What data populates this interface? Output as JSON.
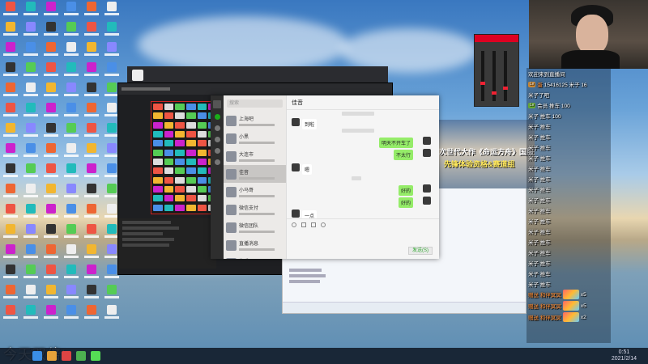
{
  "overlay": {
    "caption": "今天双倍!"
  },
  "taskbar": {
    "clock_time": "0:51",
    "clock_date": "2021/2/14"
  },
  "wechat": {
    "search_placeholder": "搜索",
    "chat_title": "佳音",
    "contacts": [
      {
        "name": "上海吧",
        "selected": false
      },
      {
        "name": "小黑",
        "selected": false
      },
      {
        "name": "大连市",
        "selected": false
      },
      {
        "name": "佳音",
        "selected": true
      },
      {
        "name": "小马哥",
        "selected": false
      },
      {
        "name": "微信支付",
        "selected": false
      },
      {
        "name": "微信团队",
        "selected": false
      },
      {
        "name": "直播消息",
        "selected": false
      },
      {
        "name": "快乐",
        "selected": false
      }
    ],
    "messages": [
      {
        "side": "left",
        "text": "到啦"
      },
      {
        "side": "right",
        "text": "明天不开车了"
      },
      {
        "side": "right",
        "text": "不太行"
      },
      {
        "side": "left",
        "text": "嗯"
      },
      {
        "side": "right",
        "text": "好的"
      },
      {
        "side": "right",
        "text": "好的"
      },
      {
        "side": "left",
        "text": "一点"
      }
    ],
    "send_label": "发送(S)"
  },
  "banner": {
    "title": "次世代大作《命运方舟》国服先锋启航",
    "subtitle": "先锋体验资格&赛道组"
  },
  "livechat": {
    "rows": [
      {
        "badge": "",
        "name": "",
        "text": "欢迎来到直播间"
      },
      {
        "badge": "Lv",
        "name": "蛋",
        "text": "15416125 米子 16"
      },
      {
        "badge": "",
        "name": "",
        "text": "米子了吧"
      },
      {
        "badge": "Lv",
        "name": "",
        "text": "会员 推车 100"
      },
      {
        "badge": "",
        "name": "",
        "text": "米子 推车 100"
      },
      {
        "badge": "",
        "name": "",
        "text": "米子 推车"
      },
      {
        "badge": "",
        "name": "",
        "text": "米子 推车"
      },
      {
        "badge": "",
        "name": "",
        "text": "米子 推车"
      },
      {
        "badge": "",
        "name": "",
        "text": "米子 推车"
      },
      {
        "badge": "",
        "name": "",
        "text": "米子 推车"
      },
      {
        "badge": "",
        "name": "",
        "text": "米子 推车"
      },
      {
        "badge": "",
        "name": "",
        "text": "米子 推车"
      },
      {
        "badge": "",
        "name": "",
        "text": "米子 推车"
      },
      {
        "badge": "",
        "name": "",
        "text": "米子 推车"
      },
      {
        "badge": "",
        "name": "",
        "text": "米子 推车"
      },
      {
        "badge": "",
        "name": "",
        "text": "米子 推车"
      },
      {
        "badge": "",
        "name": "",
        "text": "米子 推车"
      },
      {
        "badge": "",
        "name": "",
        "text": "米子 推车"
      },
      {
        "badge": "",
        "name": "",
        "text": "米子 推车"
      },
      {
        "badge": "",
        "name": "",
        "text": "米子 推车"
      },
      {
        "badge": "",
        "name": "",
        "text": "米子 推车"
      },
      {
        "badge": "",
        "name": "",
        "text": "米子 推车"
      },
      {
        "badge": "",
        "name": "",
        "text": "米子 推车"
      },
      {
        "badge": "",
        "name": "",
        "text": "米子 推车"
      },
      {
        "badge": "",
        "name": "",
        "text": "米子 推车"
      },
      {
        "badge": "",
        "name": "",
        "text": "米子 推车"
      },
      {
        "badge": "",
        "name": "",
        "text": "米子 推车"
      },
      {
        "badge": "",
        "name": "",
        "text": "米子 推车"
      },
      {
        "badge": "",
        "name": "",
        "text": "米子 推车"
      },
      {
        "badge": "",
        "name": "",
        "text": "米子 推车"
      },
      {
        "badge": "",
        "name": "",
        "text": "米子 推车"
      },
      {
        "badge": "",
        "name": "",
        "text": "米子 推车"
      }
    ],
    "gifts": [
      {
        "name": "赠送 和伴冥冥",
        "count": "x5"
      },
      {
        "name": "赠送 和伴冥冥",
        "count": "x5"
      },
      {
        "name": "赠送 和伴冥冥",
        "count": "x2"
      }
    ]
  },
  "colors": {
    "wechat_green": "#95ec69",
    "taskbar": "#141e2d",
    "live_name": "#ff8c30"
  }
}
